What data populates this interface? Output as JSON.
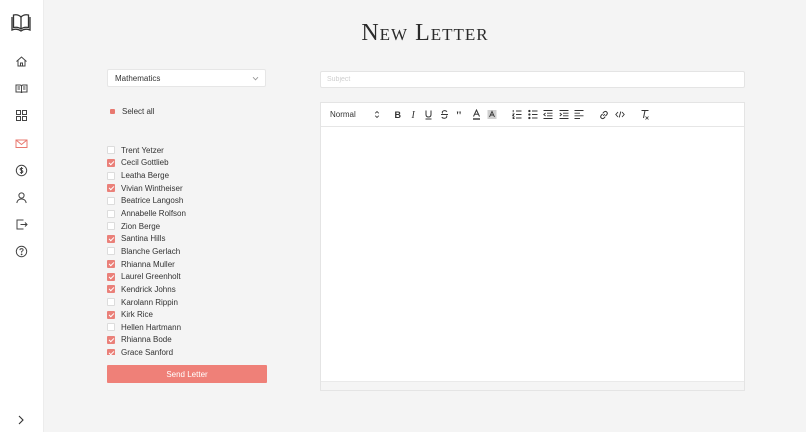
{
  "page": {
    "title": "New Letter"
  },
  "sidebar": {
    "items": [
      {
        "name": "home",
        "icon": "home-icon"
      },
      {
        "name": "courses",
        "icon": "book-open-icon"
      },
      {
        "name": "dashboard",
        "icon": "grid-icon"
      },
      {
        "name": "letters",
        "icon": "mail-icon",
        "active": true
      },
      {
        "name": "payments",
        "icon": "dollar-icon"
      },
      {
        "name": "profile",
        "icon": "user-icon"
      },
      {
        "name": "logout",
        "icon": "logout-icon"
      },
      {
        "name": "help",
        "icon": "help-icon"
      }
    ],
    "expand_icon": "chevron-right-icon"
  },
  "form": {
    "subject_select": {
      "value": "Mathematics"
    },
    "select_all_label": "Select all",
    "students": [
      {
        "name": "Trent Yetzer",
        "checked": false
      },
      {
        "name": "Cecil Gottlieb",
        "checked": true
      },
      {
        "name": "Leatha Berge",
        "checked": false
      },
      {
        "name": "Vivian Wintheiser",
        "checked": true
      },
      {
        "name": "Beatrice Langosh",
        "checked": false
      },
      {
        "name": "Annabelle Rolfson",
        "checked": false
      },
      {
        "name": "Zion Berge",
        "checked": false
      },
      {
        "name": "Santina Hills",
        "checked": true
      },
      {
        "name": "Blanche Gerlach",
        "checked": false
      },
      {
        "name": "Rhianna Muller",
        "checked": true
      },
      {
        "name": "Laurel Greenholt",
        "checked": true
      },
      {
        "name": "Kendrick Johns",
        "checked": true
      },
      {
        "name": "Karolann Rippin",
        "checked": false
      },
      {
        "name": "Kirk Rice",
        "checked": true
      },
      {
        "name": "Hellen Hartmann",
        "checked": false
      },
      {
        "name": "Rhianna Bode",
        "checked": true
      },
      {
        "name": "Grace Sanford",
        "checked": true
      }
    ],
    "send_label": "Send Letter",
    "subject_input": {
      "placeholder": "Subject",
      "value": ""
    }
  },
  "editor": {
    "toolbar": {
      "format_label": "Normal",
      "buttons": [
        "bold-icon",
        "italic-icon",
        "underline-icon",
        "strike-icon",
        "quote-icon",
        "font-color-icon",
        "background-color-icon",
        "ordered-list-icon",
        "bullet-list-icon",
        "outdent-icon",
        "indent-icon",
        "align-icon",
        "link-icon",
        "code-icon",
        "clean-format-icon"
      ]
    }
  },
  "colors": {
    "accent": "#ef8078",
    "checkbox": "#ea8079",
    "background": "#f4f4f4"
  }
}
